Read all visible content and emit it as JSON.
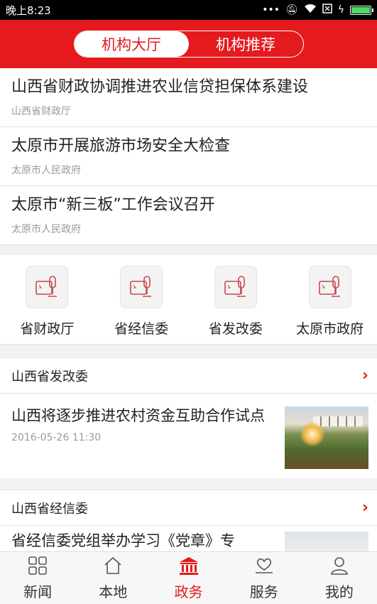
{
  "status_bar": {
    "time": "晚上8:23",
    "icons": [
      "more-dots-icon",
      "mute-icon",
      "wifi-icon",
      "sim-icon",
      "charging-icon",
      "battery-icon"
    ]
  },
  "header": {
    "tabs": [
      {
        "label": "机构大厅",
        "active": true
      },
      {
        "label": "机构推荐",
        "active": false
      }
    ],
    "accent_color": "#e51a1e"
  },
  "news": [
    {
      "title": "山西省财政协调推进农业信贷担保体系建设",
      "source": "山西省财政厅"
    },
    {
      "title": "太原市开展旅游市场安全大检查",
      "source": "太原市人民政府"
    },
    {
      "title": "太原市“新三板”工作会议召开",
      "source": "太原市人民政府"
    }
  ],
  "agencies": [
    {
      "label": "省财政厅",
      "icon": "podium-icon"
    },
    {
      "label": "省经信委",
      "icon": "podium-icon"
    },
    {
      "label": "省发改委",
      "icon": "podium-icon"
    },
    {
      "label": "太原市政府",
      "icon": "podium-icon"
    }
  ],
  "sections": [
    {
      "name": "山西省发改委",
      "article": {
        "title": "山西将逐步推进农村资金互助合作试点",
        "time": "2016-05-26 11:30"
      }
    },
    {
      "name": "山西省经信委",
      "article": {
        "title": "省经信委党组举办学习《党章》专",
        "time": ""
      }
    }
  ],
  "tabbar": [
    {
      "label": "新闻",
      "icon": "grid-icon",
      "active": false
    },
    {
      "label": "本地",
      "icon": "home-icon",
      "active": false
    },
    {
      "label": "政务",
      "icon": "government-building-icon",
      "active": true
    },
    {
      "label": "服务",
      "icon": "service-heart-icon",
      "active": false
    },
    {
      "label": "我的",
      "icon": "person-icon",
      "active": false
    }
  ]
}
